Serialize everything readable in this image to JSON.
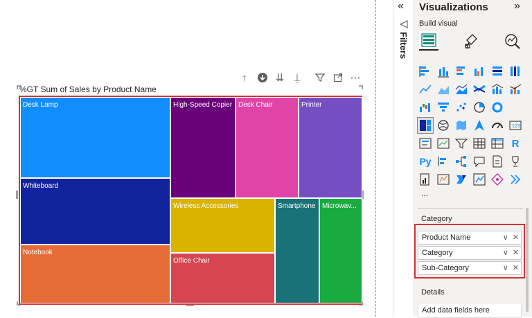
{
  "visual": {
    "title": "%GT Sum of Sales by Product Name"
  },
  "treemap": {
    "tiles": [
      {
        "label": "Desk Lamp",
        "color": "#118dff"
      },
      {
        "label": "Whiteboard",
        "color": "#12239e"
      },
      {
        "label": "Notebook",
        "color": "#e66c37"
      },
      {
        "label": "High-Speed Copier",
        "color": "#6b007b"
      },
      {
        "label": "Desk Chair",
        "color": "#e044a7"
      },
      {
        "label": "Printer",
        "color": "#744ec2"
      },
      {
        "label": "Wireless Accessories",
        "color": "#d9b300"
      },
      {
        "label": "Office Chair",
        "color": "#d64550"
      },
      {
        "label": "Smartphone",
        "color": "#197278"
      },
      {
        "label": "Microwav...",
        "color": "#1aab40"
      }
    ]
  },
  "filters": {
    "label": "Filters",
    "collapse_icon": "«"
  },
  "viz_pane": {
    "title": "Visualizations",
    "expand_icon": "»",
    "build_visual": "Build visual",
    "more": "...",
    "category_label": "Category",
    "fields": [
      "Product Name",
      "Category",
      "Sub-Category"
    ],
    "details_label": "Details",
    "add_fields": "Add data fields here"
  },
  "colors": {
    "selection_border": "#d13438",
    "pane_bg": "#f3f2f1",
    "accent": "#118dff"
  }
}
